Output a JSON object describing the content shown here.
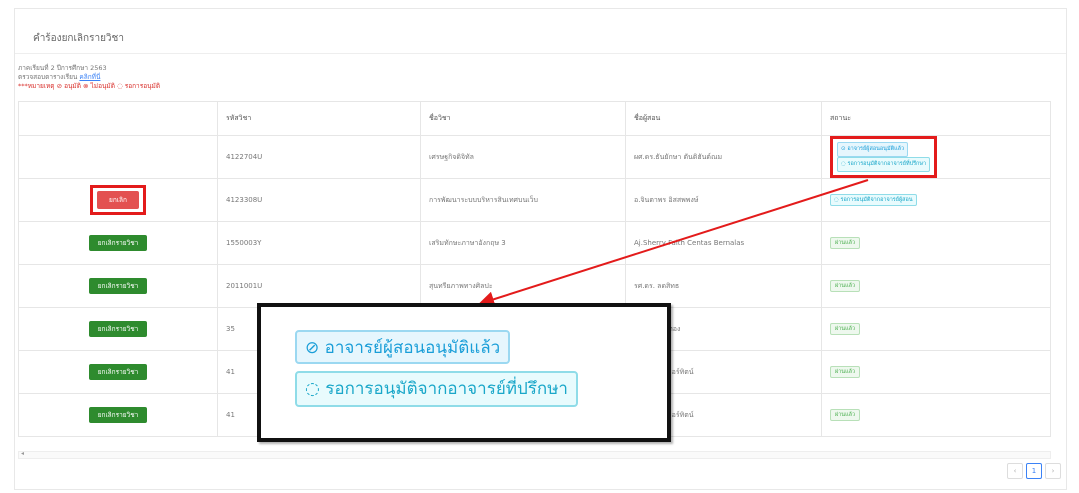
{
  "panel": {
    "title": "คำร้องยกเลิกรายวิชา"
  },
  "info": {
    "semester": "ภาคเรียนที่ 2 ปีการศึกษา 2563",
    "check_prefix": "ตรวจสอบตารางเรียน",
    "check_link": "คลิกที่นี่",
    "legend": "***หมายเหตุ ⊘ อนุมัติ ⊗ ไม่อนุมัติ ◌ รอการอนุมัติ"
  },
  "table": {
    "headers": [
      "",
      "รหัสวิชา",
      "ชื่อวิชา",
      "ชื่อผู้สอน",
      "สถานะ"
    ],
    "rows": [
      {
        "action": "",
        "code": "4122704U",
        "name": "เศรษฐกิจดิจิทัล",
        "teacher": "ผศ.ดร.ธันยักษา ตันติฮันต์ณม",
        "status": [
          "⊙ อาจารย์ผู้สอนอนุมัติแล้ว",
          "◌ รอการอนุมัติจากอาจารย์ที่ปรึกษา"
        ]
      },
      {
        "action": "ยกเลิก",
        "code": "4123308U",
        "name": "การพัฒนาระบบบริหารสินเทศบนเว็บ",
        "teacher": "อ.จินตาพร อิสสพพงษ์",
        "status": [
          "◌ รอการอนุมัติจากอาจารย์ผู้สอน"
        ]
      },
      {
        "action": "ยกเลิกรายวิชา",
        "code": "1550003Y",
        "name": "เสริมทักษะภาษาอังกฤษ 3",
        "teacher": "Aj.Sherry Faith Centas Bernalas",
        "status": [
          "ผ่านแล้ว"
        ]
      },
      {
        "action": "ยกเลิกรายวิชา",
        "code": "2011001U",
        "name": "สุนทรียภาพทางศิลปะ",
        "teacher": "รศ.ดร. ลดสิทธ",
        "status": [
          "ผ่านแล้ว"
        ]
      },
      {
        "action": "ยกเลิกรายวิชา",
        "code": "35",
        "name": "",
        "teacher": "มธุรวีน์ เงินทอง",
        "status": [
          "ผ่านแล้ว"
        ]
      },
      {
        "action": "ยกเลิกรายวิชา",
        "code": "41",
        "name": "",
        "teacher": "ผล็อปีณรงค์ อร์ทิตน์",
        "status": [
          "ผ่านแล้ว"
        ]
      },
      {
        "action": "ยกเลิกรายวิชา",
        "code": "41",
        "name": "",
        "teacher": "ผล็อปีณรงค์ อร์ทิตน์",
        "status": [
          "ผ่านแล้ว"
        ]
      }
    ]
  },
  "zoom": {
    "approved": "⊘ อาจารย์ผู้สอนอนุมัติแล้ว",
    "waiting": "◌ รอการอนุมัติจากอาจารย์ที่ปรึกษา"
  },
  "pager": {
    "prev": "‹",
    "page": "1",
    "next": "›"
  },
  "colors": {
    "annotation_red": "#e31b1b",
    "cancel_green": "#2e8b2e",
    "cancel_red": "#e35151"
  }
}
